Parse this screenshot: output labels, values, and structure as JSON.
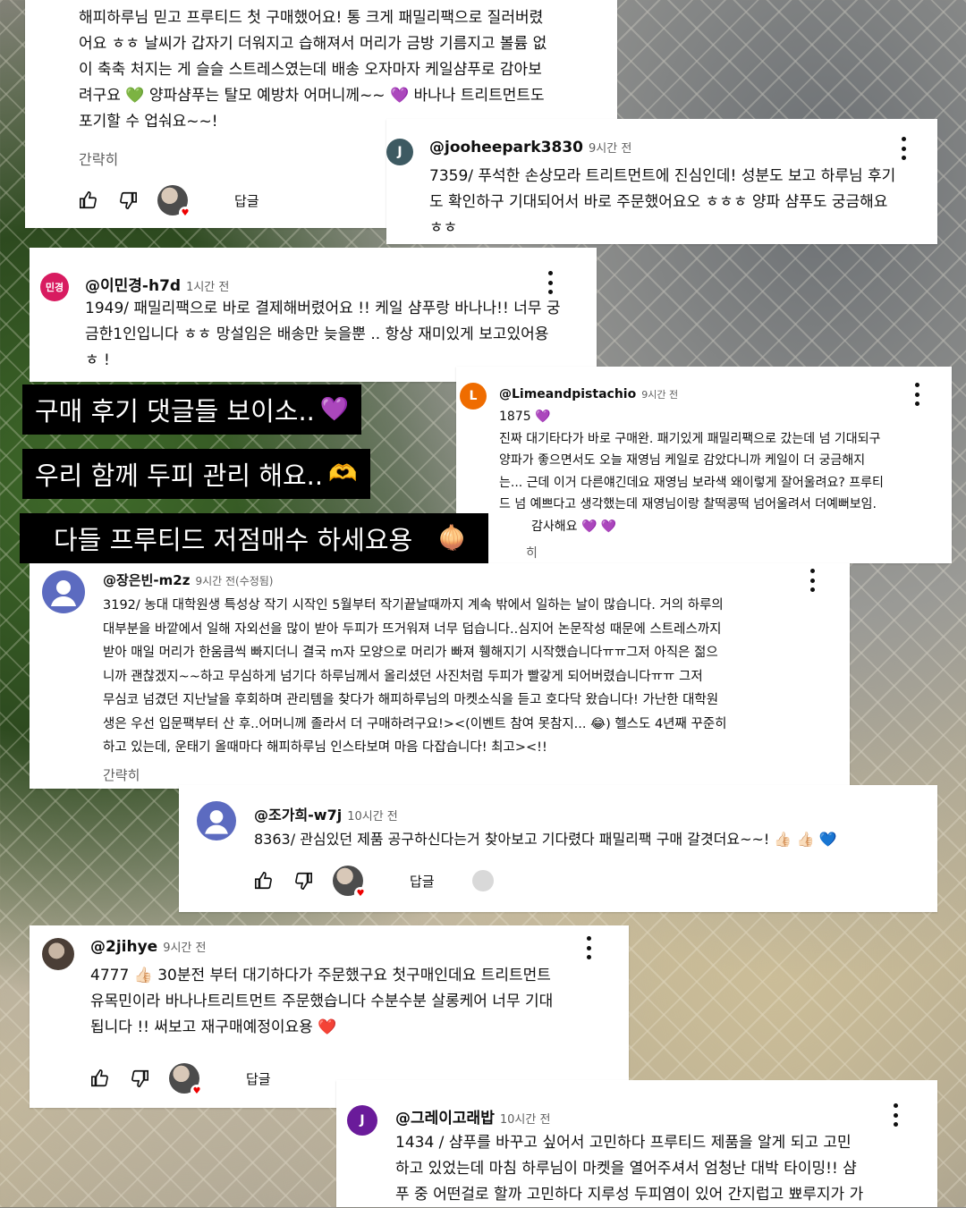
{
  "comments": [
    {
      "id": "top",
      "lines": [
        "해피하루님 믿고 프루티드 첫 구매했어요! 통 크게 패밀리팩으로 질러버렸",
        "어요 ㅎㅎ 날씨가 갑자기 더워지고 습해져서 머리가 금방 기름지고 볼륨 없",
        "이 축축 처지는 게 슬슬 스트레스였는데 배송 오자마자 케일샴푸로 감아보",
        "려구요 💚 양파샴푸는 탈모 예방차 어머니께~~ 💜 바나나 트리트먼트도",
        "포기할 수 업숴요~~!"
      ],
      "more": "간략히",
      "reply": "답글"
    },
    {
      "id": "jooheepark",
      "handle": "@jooheepark3830",
      "time": "9시간 전",
      "avatar_letter": "J",
      "lines": [
        "7359/ 푸석한 손상모라 트리트먼트에 진심인데! 성분도 보고 하루님 후기",
        "도 확인하구 기대되어서 바로 주문했어요오 ㅎㅎㅎ 양파 샴푸도 궁금해요",
        "ㅎㅎ"
      ]
    },
    {
      "id": "leeminkyung",
      "handle": "@이민경-h7d",
      "time": "1시간 전",
      "avatar_letter": "민경",
      "lines": [
        "1949/ 패밀리팩으로 바로 결제해버렸어요 !! 케일 샴푸랑 바나나!! 너무 궁",
        "금한1인입니다 ㅎㅎ 망설임은 배송만 늦을뿐 .. 항상 재미있게 보고있어용",
        "ㅎ !"
      ]
    },
    {
      "id": "limeandpistachio",
      "handle": "@Limeandpistachio",
      "time": "9시간 전",
      "avatar_letter": "L",
      "lines": [
        "1875 💜",
        "진짜 대기타다가 바로 구매완. 패기있게 패밀리팩으로 갔는데 넘 기대되구",
        "양파가 좋으면서도 오늘 재영님 케일로 감았다니까 케일이 더 궁금해지",
        "는... 근데 이거 다른얘긴데요 재영님 보라색 왜이렇게 잘어울려요? 프루티",
        "드 넘 예쁘다고 생각했는데 재영님이랑 찰떡콩떡 넘어울려서 더예뻐보임.",
        "감사해요 💜 💜"
      ],
      "more": "히"
    },
    {
      "id": "jangeunbin",
      "handle": "@장은빈-m2z",
      "time": "9시간 전(수정됨)",
      "lines": [
        "3192/ 농대 대학원생 특성상 작기 시작인 5월부터 작기끝날때까지 계속 밖에서 일하는 날이 많습니다. 거의 하루의",
        "대부분을 바깥에서 일해 자외선을 많이 받아 두피가 뜨거워져 너무 덥습니다..심지어 논문작성 때문에 스트레스까지",
        "받아 매일 머리가 한움큼씩 빠지더니 결국 m자 모양으로 머리가 빠져 휑해지기 시작했습니다ㅠㅠ그저 아직은 젊으",
        "니까 괜찮겠지~~하고 무심하게 넘기다 하루님께서 올리셨던 사진처럼 두피가 빨갛게 되어버렸습니다ㅠㅠ 그저",
        "무심코 넘겼던 지난날을 후회하며 관리템을 찾다가 해피하루님의 마켓소식을 듣고 호다닥 왔습니다! 가난한 대학원",
        "생은 우선 입문팩부터 산 후..어머니께 졸라서 더 구매하려구요!><(이벤트 참여 못참지... 😂) 헬스도 4년째 꾸준히",
        "하고 있는데, 운태기 올때마다 해피하루님 인스타보며 마음 다잡습니다! 최고><!!"
      ],
      "more": "간략히"
    },
    {
      "id": "jogahee",
      "handle": "@조가희-w7j",
      "time": "10시간 전",
      "lines": [
        "8363/ 관심있던 제품 공구하신다는거 찾아보고 기다렸다 패밀리팩 구매 갈겻더요~~! 👍🏻 👍🏻 💙"
      ],
      "reply": "답글"
    },
    {
      "id": "2jihye",
      "handle": "@2jihye",
      "time": "9시간 전",
      "lines": [
        "4777 👍🏻 30분전 부터 대기하다가 주문했구요  첫구매인데요 트리트먼트",
        "유목민이라 바나나트리트먼트 주문했습니다 수분수분 살롱케어 너무 기대",
        "됩니다 !! 써보고 재구매예정이요용 ❤️"
      ],
      "reply": "답글"
    },
    {
      "id": "greyrabbit",
      "handle": "@그레이고래밥",
      "time": "10시간 전",
      "avatar_letter": "J",
      "lines": [
        "1434 / 샴푸를 바꾸고 싶어서 고민하다 프루티드 제품을 알게 되고 고민",
        "하고 있었는데 마침 하루님이 마켓을 열어주셔서 엄청난 대박 타이밍!! 샴",
        "푸 중 어떤걸로 할까 고민하다 지루성 두피염이 있어 간지럽고 뾰루지가 가"
      ]
    }
  ],
  "banners": [
    {
      "text": "구매 후기 댓글들 보이소..",
      "emoji": "💜"
    },
    {
      "text": "우리 함께 두피 관리 해요..",
      "emoji": "🫶"
    },
    {
      "text": "다들 프루티드 저점매수 하세요용",
      "emoji": "🧅"
    }
  ],
  "colors": {
    "avatar_dark_teal": "#3d5a62",
    "avatar_pink": "#d81b60",
    "avatar_orange": "#ef6c00",
    "avatar_blue": "#5c6bc0",
    "avatar_purple": "#6a1b9a"
  }
}
